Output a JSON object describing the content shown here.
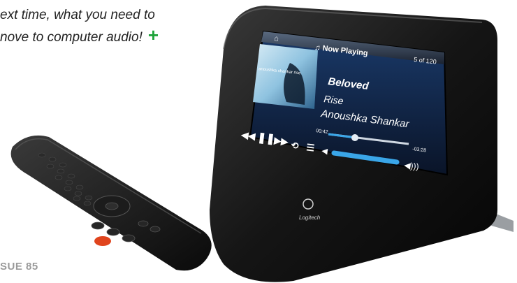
{
  "caption": {
    "line1": "ext time, what you need to",
    "line2": "nove to computer audio!",
    "plus": "+"
  },
  "issue_label": "SUE 85",
  "device": {
    "brand": "Logitech",
    "screen": {
      "header_title": "♫ Now Playing",
      "track_counter": "5 of 120",
      "album_art_text": "anoushka shankar rise",
      "track_title": "Beloved",
      "album": "Rise",
      "artist": "Anoushka Shankar",
      "elapsed": "00:42",
      "remaining": "-03:28",
      "progress": 0.2,
      "volume": 0.72
    }
  },
  "colors": {
    "plus_green": "#1fa33a",
    "screen_accent": "#3aa6e8"
  }
}
